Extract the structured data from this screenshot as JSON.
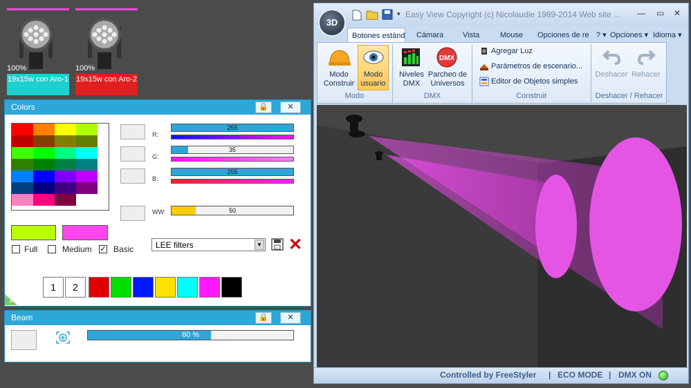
{
  "fixtures": [
    {
      "percent": "100%",
      "name": "19x15w con Aro-1",
      "color": "#1ed0d0"
    },
    {
      "percent": "100%",
      "name": "19x15w con Aro-2",
      "color": "#e02020"
    }
  ],
  "colors_panel": {
    "title": "Colors",
    "lock_label": "🔒",
    "close_label": "✕",
    "r_label": "R:",
    "r_value": "255",
    "r_fraction": 1.0,
    "g_label": "G:",
    "g_value": "35",
    "g_fraction": 0.137,
    "b_label": "B:",
    "b_value": "255",
    "b_fraction": 1.0,
    "ww_label": "WW:",
    "ww_value": "50",
    "ww_fraction": 0.2,
    "current_color_a": "#b8ff00",
    "current_color_b": "#ff46ee",
    "full_label": "Full",
    "full_checked": false,
    "medium_label": "Medium",
    "medium_checked": false,
    "basic_label": "Basic",
    "basic_checked": true,
    "check_mark": "✓",
    "filter_select": "LEE filters",
    "dropdown_arrow": "▼",
    "delete_label": "✕",
    "quick_1": "1",
    "quick_2": "2",
    "quick_colors": [
      "#e00000",
      "#00e000",
      "#0018ff",
      "#ffe000",
      "#00ffff",
      "#ff18ff",
      "#000000"
    ],
    "palette": [
      "#ff0000",
      "#ff8000",
      "#ffff00",
      "#b0ff00",
      "#c00000",
      "#804000",
      "#808000",
      "#608000",
      "#40ff00",
      "#00ff00",
      "#00ff80",
      "#00ffff",
      "#308000",
      "#008000",
      "#008040",
      "#008080",
      "#0080ff",
      "#0000ff",
      "#8000ff",
      "#c000ff",
      "#004080",
      "#000080",
      "#400080",
      "#800080",
      "#ff80c0",
      "#ff0080",
      "#800040",
      "#ffffff"
    ]
  },
  "beam_panel": {
    "title": "Beam",
    "lock_label": "🔒",
    "close_label": "✕",
    "value_label": "60 %",
    "value_fraction": 0.6
  },
  "app": {
    "title": "Easy View  Copyright (c) Nicolaudie 1989-2014   Web site ...",
    "logo": "3D",
    "tabs": [
      "Botones estánd",
      "Cámara",
      "Vista",
      "Mouse",
      "Opciones de re"
    ],
    "help_menu": "? ▾",
    "opciones_menu": "Opciones ▾",
    "idioma_menu": "Idioma ▾",
    "minimize": "—",
    "restore": "▭",
    "close": "✕",
    "groups": {
      "modo": "Modo",
      "dmx": "DMX",
      "construir": "Construir",
      "deshacer": "Deshacer / Rehacer"
    },
    "buttons": {
      "modo_construir": "Modo Construir",
      "modo_usuario": "Modo usuario",
      "niveles_dmx": "Niveles DMX",
      "parcheo": "Parcheo de Universos",
      "agregar_luz": "Agregar Luz",
      "parametros": "Parámetros de escenario...",
      "editor": "Editor de Objetos simples",
      "deshacer": "Deshacer",
      "rehacer": "Rehacer"
    },
    "status": {
      "controlled": "Controlled by FreeStyler",
      "eco": "ECO MODE",
      "dmx": "DMX ON",
      "sep": "|"
    }
  }
}
